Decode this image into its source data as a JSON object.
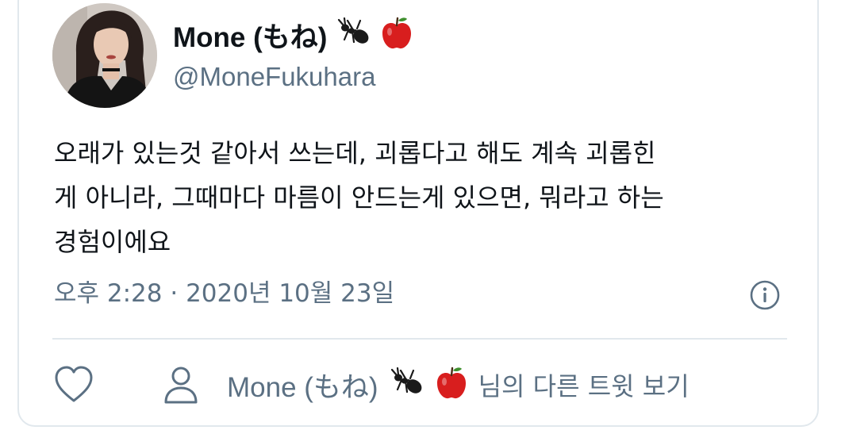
{
  "user": {
    "display_name": "Mone (もね)",
    "handle": "@MoneFukuhara",
    "badges": [
      "ant-emoji-icon",
      "apple-emoji-icon"
    ]
  },
  "tweet": {
    "lines": [
      "오래가 있는것 같아서 쓰는데, 괴롭다고 해도 계속 괴롭힌",
      "게 아니라, 그때마다 마름이 안드는게 있으면, 뭐라고 하는",
      "경험이에요"
    ],
    "timestamp": "오후 2:28 · 2020년 10월 23일"
  },
  "actions": {
    "like_icon": "heart-icon",
    "info_icon": "info-icon",
    "profile_icon": "user-icon",
    "profile_link_name": "Mone (もね)",
    "profile_link_suffix": "님의 다른 트윗 보기"
  },
  "colors": {
    "text_primary": "#0f1419",
    "text_secondary": "#5b7083",
    "border": "#e1e8ed",
    "apple_red": "#d81e1e"
  }
}
